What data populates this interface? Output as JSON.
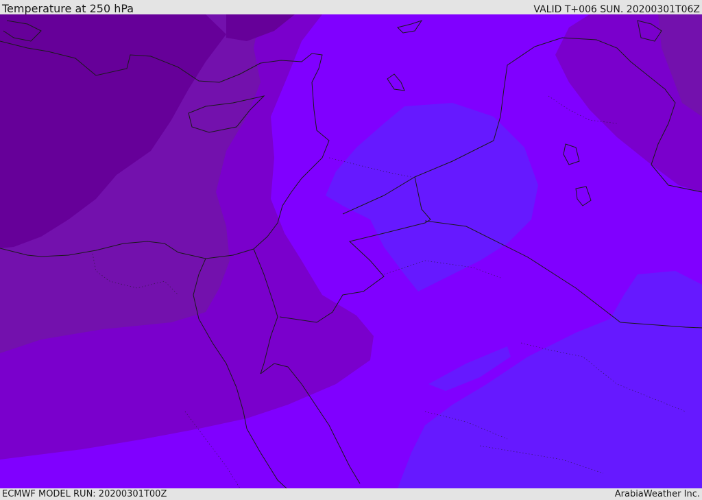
{
  "header": {
    "title": "Temperature at 250 hPa",
    "valid_time": "VALID T+006 SUN. 20200301T06Z"
  },
  "footer": {
    "model_run": "ECMWF MODEL RUN: 20200301T00Z",
    "credit": "ArabiaWeather Inc."
  },
  "colors": {
    "coldest": "#660099",
    "cold": "#7311ad",
    "cool": "#7a00cc",
    "mid": "#8000ff",
    "warm": "#6619ff",
    "outline": "#1a1a1a",
    "frame": "#e4e4e4"
  }
}
